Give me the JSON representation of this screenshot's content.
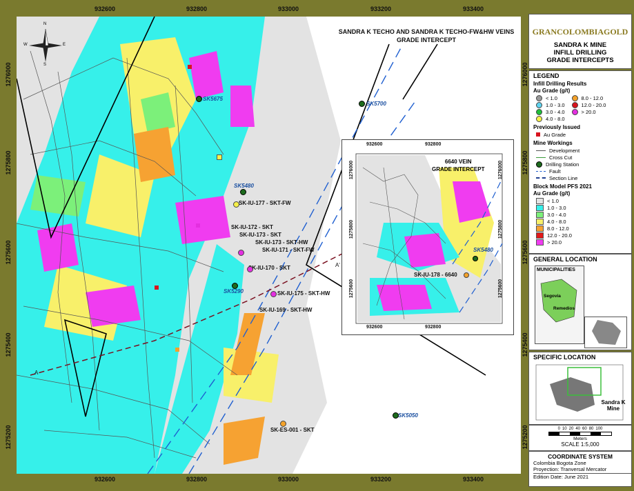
{
  "header": {
    "logo_text": "GRANCOLOMBIAGOLD",
    "title_lines": [
      "SANDRA K MINE",
      "INFILL DRILLING",
      "GRADE INTERCEPTS"
    ]
  },
  "map": {
    "title_lines": [
      "SANDRA K TECHO AND SANDRA K TECHO-FW&HW VEINS",
      "GRADE INTERCEPT"
    ],
    "x_ticks": [
      "932600",
      "932800",
      "933000",
      "933200",
      "933400"
    ],
    "y_ticks": [
      "1276000",
      "1275800",
      "1275600",
      "1275400",
      "1275200"
    ],
    "compass": {
      "n": "N",
      "s": "S",
      "e": "E",
      "w": "W"
    },
    "section_labels": {
      "a": "A",
      "a_prime": "A'"
    },
    "stations": [
      "SK5675",
      "SK5700",
      "SK5480",
      "SK5290",
      "SK5050"
    ],
    "intercepts": [
      "SK-IU-177 - SKT-FW",
      "SK-IU-172 - SKT",
      "SK-IU-173 - SKT",
      "SK-IU-173 - SKT-HW",
      "SK-IU-171 - SKT-FW",
      "SK-IU-170 - SKT",
      "SK-IU-175 - SKT-HW",
      "SK-IU-169 - SKT-HW",
      "SK-ES-001 - SKT"
    ]
  },
  "inset": {
    "title_lines": [
      "6640 VEIN",
      "GRADE INTERCEPT"
    ],
    "x_ticks": [
      "932600",
      "932800"
    ],
    "y_ticks": [
      "1276000",
      "1275800",
      "1275600"
    ],
    "station": "SK5480",
    "intercept": "SK-IU-178 - 6640"
  },
  "legend": {
    "title": "LEGEND",
    "infill_title": "Infill Drilling Results",
    "infill_unit": "Au Grade (g/t)",
    "infill_items": [
      {
        "label": "< 1.0",
        "color": "#9a9a9a"
      },
      {
        "label": "1.0 - 3.0",
        "color": "#5fd4f0"
      },
      {
        "label": "3.0 - 4.0",
        "color": "#1fbf3a"
      },
      {
        "label": "4.0 - 8.0",
        "color": "#f6f04a"
      },
      {
        "label": "8.0 - 12.0",
        "color": "#f4a22a"
      },
      {
        "label": "12.0 - 20.0",
        "color": "#d8141e"
      },
      {
        "label": "> 20.0",
        "color": "#e42fe0"
      }
    ],
    "prev_title": "Previously Issued",
    "prev_item": "Au Grade",
    "workings_title": "Mine Workings",
    "workings_items": [
      "Development",
      "Cross Cut",
      "Drilling Station",
      "Fault",
      "Section Line"
    ],
    "block_title": "Block Model PFS 2021",
    "block_unit": "Au Grade (g/t)",
    "block_items": [
      {
        "label": "< 1.0",
        "color": "#e3e3e3"
      },
      {
        "label": "1.0 - 3.0",
        "color": "#36f0ea"
      },
      {
        "label": "3.0 - 4.0",
        "color": "#7cf07a"
      },
      {
        "label": "4.0 - 8.0",
        "color": "#f8f06a"
      },
      {
        "label": "8.0 - 12.0",
        "color": "#f6a232"
      },
      {
        "label": "12.0 - 20.0",
        "color": "#e21a1a"
      },
      {
        "label": "> 20.0",
        "color": "#f03cf0"
      }
    ]
  },
  "general_location": {
    "title": "GENERAL LOCATION",
    "box_title": "MUNICIPALITIES",
    "towns": [
      "Segovia",
      "Remedios"
    ]
  },
  "specific_location": {
    "title": "SPECIFIC LOCATION",
    "label": "Sandra K Mine"
  },
  "scale": {
    "ticks": [
      "0",
      "10",
      "20",
      "40",
      "60",
      "80",
      "100"
    ],
    "unit": "Meters",
    "text": "SCALE 1:5,000"
  },
  "coordinate_system": {
    "title": "COORDINATE SYSTEM",
    "zone": "Colombia Bogota Zone",
    "projection": "Proyection: Tranversal Mercator",
    "edition": "Edition Date: June 2021"
  },
  "colors": {
    "frame": "#7a7a2e",
    "station_text": "#1a4fa0"
  }
}
